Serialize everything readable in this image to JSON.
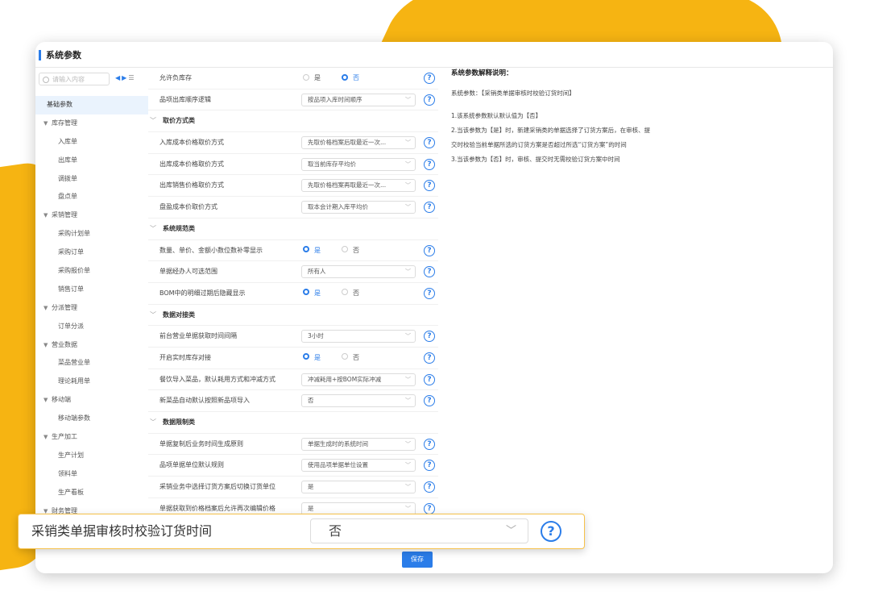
{
  "window": {
    "title": "系统参数"
  },
  "sidebar": {
    "search_placeholder": "请输入内容",
    "items": [
      {
        "label": "基础参数",
        "level": 0,
        "active": true
      },
      {
        "label": "库存管理",
        "level": 0,
        "group": true
      },
      {
        "label": "入库单",
        "level": 1
      },
      {
        "label": "出库单",
        "level": 1
      },
      {
        "label": "调拨单",
        "level": 1
      },
      {
        "label": "盘点单",
        "level": 1
      },
      {
        "label": "采销管理",
        "level": 0,
        "group": true
      },
      {
        "label": "采购计划单",
        "level": 1
      },
      {
        "label": "采购订单",
        "level": 1
      },
      {
        "label": "采购报价单",
        "level": 1
      },
      {
        "label": "销售订单",
        "level": 1
      },
      {
        "label": "分派管理",
        "level": 0,
        "group": true
      },
      {
        "label": "订单分派",
        "level": 1
      },
      {
        "label": "营业数据",
        "level": 0,
        "group": true
      },
      {
        "label": "菜品营业单",
        "level": 1
      },
      {
        "label": "理论耗用单",
        "level": 1
      },
      {
        "label": "移动端",
        "level": 0,
        "group": true
      },
      {
        "label": "移动端参数",
        "level": 1
      },
      {
        "label": "生产加工",
        "level": 0,
        "group": true
      },
      {
        "label": "生产计划",
        "level": 1
      },
      {
        "label": "领料单",
        "level": 1
      },
      {
        "label": "生产看板",
        "level": 1
      },
      {
        "label": "财务管理",
        "level": 0,
        "group": true
      }
    ]
  },
  "radio_labels": {
    "yes": "是",
    "no": "否"
  },
  "settings": [
    {
      "type": "radio",
      "label": "允许负库存",
      "selected": "no"
    },
    {
      "type": "select",
      "label": "品项出库顺序逻辑",
      "value": "按品项入库时间顺序"
    },
    {
      "type": "section",
      "label": "取价方式类"
    },
    {
      "type": "select",
      "label": "入库成本价格取价方式",
      "value": "先取价格档案后取最近一次..."
    },
    {
      "type": "select",
      "label": "出库成本价格取价方式",
      "value": "取当前库存平均价"
    },
    {
      "type": "select",
      "label": "出库销售价格取价方式",
      "value": "先取价格档案再取最近一次..."
    },
    {
      "type": "select",
      "label": "盘盈成本价取价方式",
      "value": "取本会计期入库平均价"
    },
    {
      "type": "section",
      "label": "系统规范类"
    },
    {
      "type": "radio",
      "label": "数量、单价、金额小数位数补零显示",
      "selected": "yes"
    },
    {
      "type": "select",
      "label": "单据经办人可选范围",
      "value": "所有人"
    },
    {
      "type": "radio",
      "label": "BOM中的明细过期后隐藏显示",
      "selected": "yes"
    },
    {
      "type": "section",
      "label": "数据对接类"
    },
    {
      "type": "select",
      "label": "前台营业单据获取时间间隔",
      "value": "3小时"
    },
    {
      "type": "radio",
      "label": "开启实时库存对接",
      "selected": "yes"
    },
    {
      "type": "select",
      "label": "餐饮导入菜品，默认耗用方式和冲减方式",
      "value": "冲减耗用+按BOM实际冲减"
    },
    {
      "type": "select",
      "label": "新菜品自动默认按照新品项导入",
      "value": "否"
    },
    {
      "type": "section",
      "label": "数据限制类"
    },
    {
      "type": "select",
      "label": "单据复制后业务时间生成原则",
      "value": "单据生成时的系统时间"
    },
    {
      "type": "select",
      "label": "品项单据单位默认规则",
      "value": "使用品项单据单位设置"
    },
    {
      "type": "select",
      "label": "采销业务中选择订货方案后切换订货单位",
      "value": "是"
    },
    {
      "type": "select",
      "label": "单据获取到价格档案后允许再次编辑价格",
      "value": "是"
    }
  ],
  "explain": {
    "title": "系统参数解释说明：",
    "param_line": "系统参数：【采销类单据审核时校验订货时间】",
    "lines": [
      "1.该系统参数默认默认值为【否】",
      "2.当该参数为【是】时，新建采销类的单据选择了订货方案后，在审核、提",
      "交时校验当前单据所选的订货方案是否超过所选“订货方案”的时间",
      "3.当该参数为【否】时，审核、提交时无需校验订货方案中时间"
    ]
  },
  "save_label": "保存",
  "zoom": {
    "label": "采销类单据审核时校验订货时间",
    "value": "否"
  },
  "colors": {
    "accent": "#2b7de9",
    "brand_yellow": "#f6b412"
  },
  "icons": {
    "help": "question-circle-icon",
    "dropdown": "chevron-down-icon",
    "search": "search-icon"
  }
}
